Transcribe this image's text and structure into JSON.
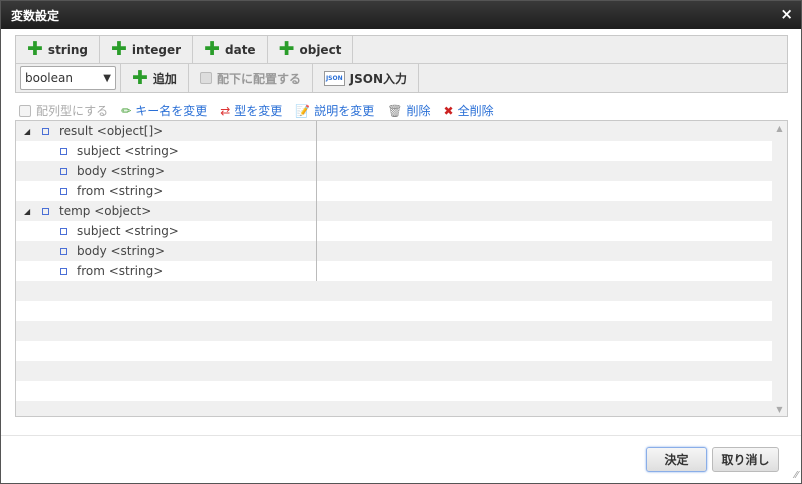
{
  "title": "変数設定",
  "close": "×",
  "type_buttons": [
    "string",
    "integer",
    "date",
    "object"
  ],
  "type_select": "boolean",
  "add_label": "追加",
  "place_under_label": "配下に配置する",
  "json_label": "JSON入力",
  "json_icon_text": "JSON",
  "array_label": "配列型にする",
  "links": {
    "rename": "キー名を変更",
    "change_type": "型を変更",
    "change_desc": "説明を変更",
    "delete": "削除",
    "delete_all": "全削除"
  },
  "tree": [
    {
      "label": "result <object[]>",
      "level": 0
    },
    {
      "label": "subject <string>",
      "level": 1
    },
    {
      "label": "body <string>",
      "level": 1
    },
    {
      "label": "from <string>",
      "level": 1
    },
    {
      "label": "temp <object>",
      "level": 0
    },
    {
      "label": "subject <string>",
      "level": 1
    },
    {
      "label": "body <string>",
      "level": 1
    },
    {
      "label": "from <string>",
      "level": 1
    }
  ],
  "ok": "決定",
  "cancel": "取り消し"
}
